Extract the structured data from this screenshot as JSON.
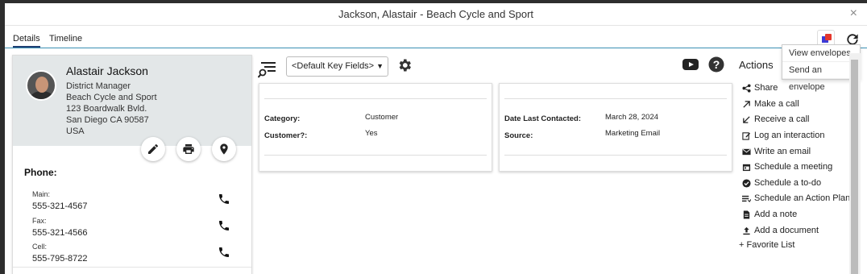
{
  "window": {
    "title": "Jackson, Alastair - Beach Cycle and Sport",
    "close_label": "×"
  },
  "tabs": [
    {
      "label": "Details"
    },
    {
      "label": "Timeline"
    }
  ],
  "envelope_menu": {
    "items": [
      {
        "label": "View envelopes"
      },
      {
        "label": "Send an envelope"
      }
    ]
  },
  "contact": {
    "name": "Alastair Jackson",
    "title": "District Manager",
    "company": "Beach Cycle and Sport",
    "street": "123 Boardwalk Bvld.",
    "city": "San Diego CA 90587",
    "country": "USA"
  },
  "phone": {
    "heading": "Phone:",
    "entries": [
      {
        "label": "Main:",
        "number": "555-321-4567"
      },
      {
        "label": "Fax:",
        "number": "555-321-4566"
      },
      {
        "label": "Cell:",
        "number": "555-795-8722"
      }
    ]
  },
  "key_fields": {
    "selected": "<Default Key Fields>",
    "panel_left": [
      {
        "label": "Category:",
        "value": "Customer"
      },
      {
        "label": "Customer?:",
        "value": "Yes"
      }
    ],
    "panel_right": [
      {
        "label": "Date Last Contacted:",
        "value": "March 28, 2024"
      },
      {
        "label": "Source:",
        "value": "Marketing Email"
      }
    ]
  },
  "actions": {
    "heading": "Actions",
    "items": [
      {
        "label": "Share",
        "icon": "share-icon"
      },
      {
        "label": "Make a call",
        "icon": "arrow-up-right-icon"
      },
      {
        "label": "Receive a call",
        "icon": "arrow-down-left-icon"
      },
      {
        "label": "Log an interaction",
        "icon": "edit-icon"
      },
      {
        "label": "Write an email",
        "icon": "mail-icon"
      },
      {
        "label": "Schedule a meeting",
        "icon": "calendar-icon"
      },
      {
        "label": "Schedule a to-do",
        "icon": "check-circle-icon"
      },
      {
        "label": "Schedule an Action Plan",
        "icon": "list-icon"
      },
      {
        "label": "Add a note",
        "icon": "note-icon"
      },
      {
        "label": "Add a document",
        "icon": "upload-icon"
      }
    ],
    "favorite": "+ Favorite List"
  },
  "colors": {
    "accent": "#3a8fb3",
    "card_header": "#e3e7e8",
    "tab_underline": "#1f3f73"
  }
}
